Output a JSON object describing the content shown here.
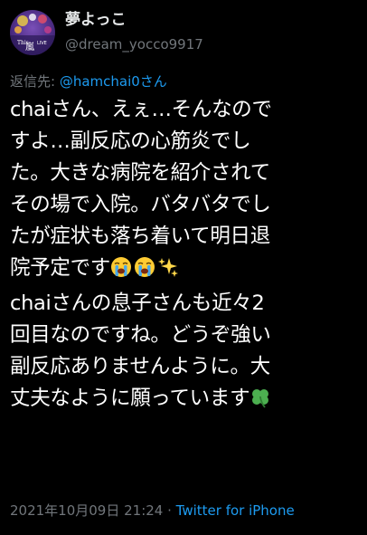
{
  "user": {
    "display_name": "夢よっこ",
    "handle": "@dream_yocco9917",
    "avatar_label": "This is LIVE 嵐"
  },
  "reply": {
    "prefix": "返信先: ",
    "target": "@hamchai0さん"
  },
  "body": {
    "line1": "chaiさん、えぇ…そんなので",
    "line2": "すよ…副反応の心筋炎でし",
    "line3": "た。大きな病院を紹介されて",
    "line4": "その場で入院。バタバタでし",
    "line5": "たが症状も落ち着いて明日退",
    "line6": "院予定です",
    "line7": "chaiさんの息子さんも近々2",
    "line8": "回目なのですね。どうぞ強い",
    "line9": "副反応ありませんように。大",
    "line10": "丈夫なように願っています"
  },
  "emojis": {
    "line6": [
      "loudly-crying-face-icon",
      "loudly-crying-face-icon",
      "sparkles-icon"
    ],
    "line10": [
      "four-leaf-clover-icon"
    ]
  },
  "meta": {
    "timestamp": "2021年10月09日 21:24",
    "separator": " · ",
    "source": "Twitter for iPhone"
  },
  "colors": {
    "background": "#000000",
    "text": "#ffffff",
    "secondary": "#71767b",
    "link": "#1d9bf0"
  }
}
